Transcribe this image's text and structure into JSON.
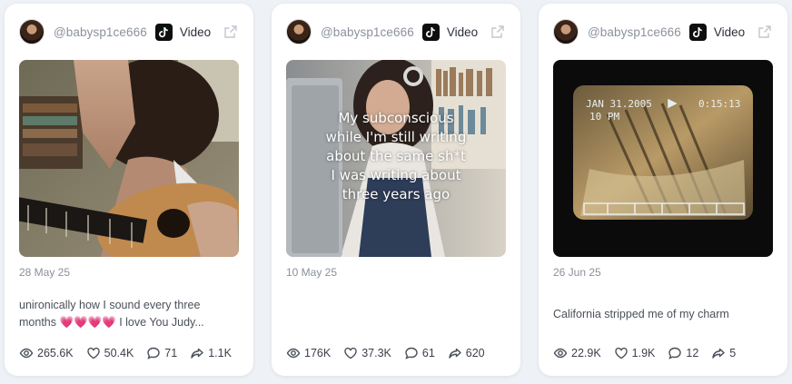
{
  "cards": [
    {
      "handle": "@babysp1ce666",
      "platform_icon": "tiktok-icon",
      "type_label": "Video",
      "date": "28 May 25",
      "caption": "unironically how I sound every three months 💗💗💗💗 I love You Judy...",
      "overlay_lines": [],
      "stats": {
        "views": "265.6K",
        "likes": "50.4K",
        "comments": "71",
        "shares": "1.1K"
      }
    },
    {
      "handle": "@babysp1ce666",
      "platform_icon": "tiktok-icon",
      "type_label": "Video",
      "date": "10 May 25",
      "caption": "",
      "overlay_lines": [
        "My subconscious",
        "while I'm still writing",
        "about the same sh*t",
        "I was writing about",
        "three years ago"
      ],
      "stats": {
        "views": "176K",
        "likes": "37.3K",
        "comments": "61",
        "shares": "620"
      }
    },
    {
      "handle": "@babysp1ce666",
      "platform_icon": "tiktok-icon",
      "type_label": "Video",
      "date": "26 Jun 25",
      "caption": "California stripped me of my charm",
      "overlay_lines": [],
      "stats": {
        "views": "22.9K",
        "likes": "1.9K",
        "comments": "12",
        "shares": "5"
      }
    }
  ],
  "icons": {
    "views": "eye-icon",
    "likes": "heart-icon",
    "comments": "comment-icon",
    "shares": "share-icon",
    "open": "external-link-icon"
  },
  "colors": {
    "page_bg": "#eef1f5",
    "card_bg": "#ffffff",
    "muted_text": "#8a909a",
    "heart_emoji": "#e8457a"
  }
}
